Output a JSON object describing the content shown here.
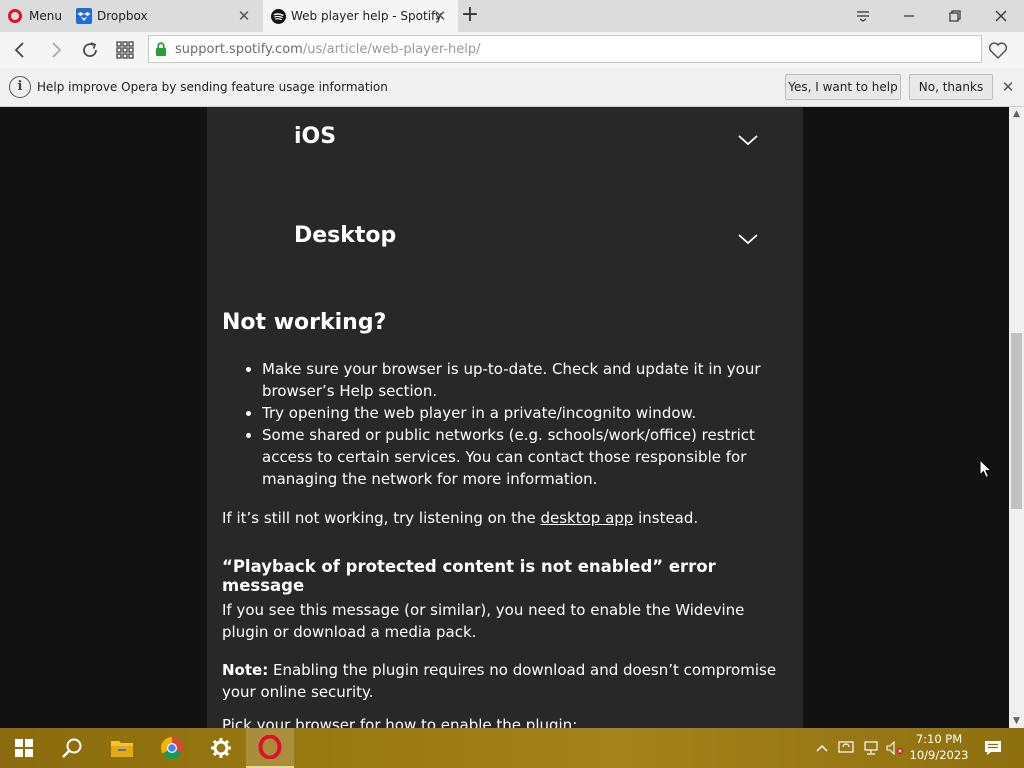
{
  "browser": {
    "menu_label": "Menu",
    "tabs": [
      {
        "title": "Dropbox",
        "active": false,
        "icon": "dropbox-icon"
      },
      {
        "title": "Web player help - Spotify",
        "active": true,
        "icon": "spotify-icon"
      }
    ],
    "url_host": "support.spotify.com",
    "url_path": "/us/article/web-player-help/"
  },
  "infobar": {
    "message": "Help improve Opera by sending feature usage information",
    "accept_label": "Yes, I want to help",
    "decline_label": "No, thanks"
  },
  "article": {
    "accordions": [
      {
        "title": "iOS"
      },
      {
        "title": "Desktop"
      }
    ],
    "not_working_heading": "Not working?",
    "bullets": [
      "Make sure your browser is up-to-date. Check and update it in your browser’s Help section.",
      "Try opening the web player in a private/incognito window.",
      "Some shared or public networks (e.g. schools/work/office) restrict access to certain services. You can contact those responsible for managing the network for more information."
    ],
    "still_not_working_prefix": "If it’s still not working, try listening on the ",
    "desktop_app_link": "desktop app",
    "still_not_working_suffix": " instead.",
    "playback_heading": "“Playback of protected content is not enabled” error message",
    "widevine_text": "If you see this message (or similar), you need to enable the Widevine plugin or download a media pack.",
    "note_label": "Note:",
    "note_text": " Enabling the plugin requires no download and doesn’t compromise your online security.",
    "cut_off_text": "Pick your browser for how to enable the plugin:"
  },
  "taskbar": {
    "time": "7:10 PM",
    "date": "10/9/2023"
  },
  "colors": {
    "page_bg": "#121212",
    "article_bg": "#282828",
    "opera_red": "#e0102a",
    "spotify_green": "#1db954",
    "taskbar": "#9c7c12"
  }
}
